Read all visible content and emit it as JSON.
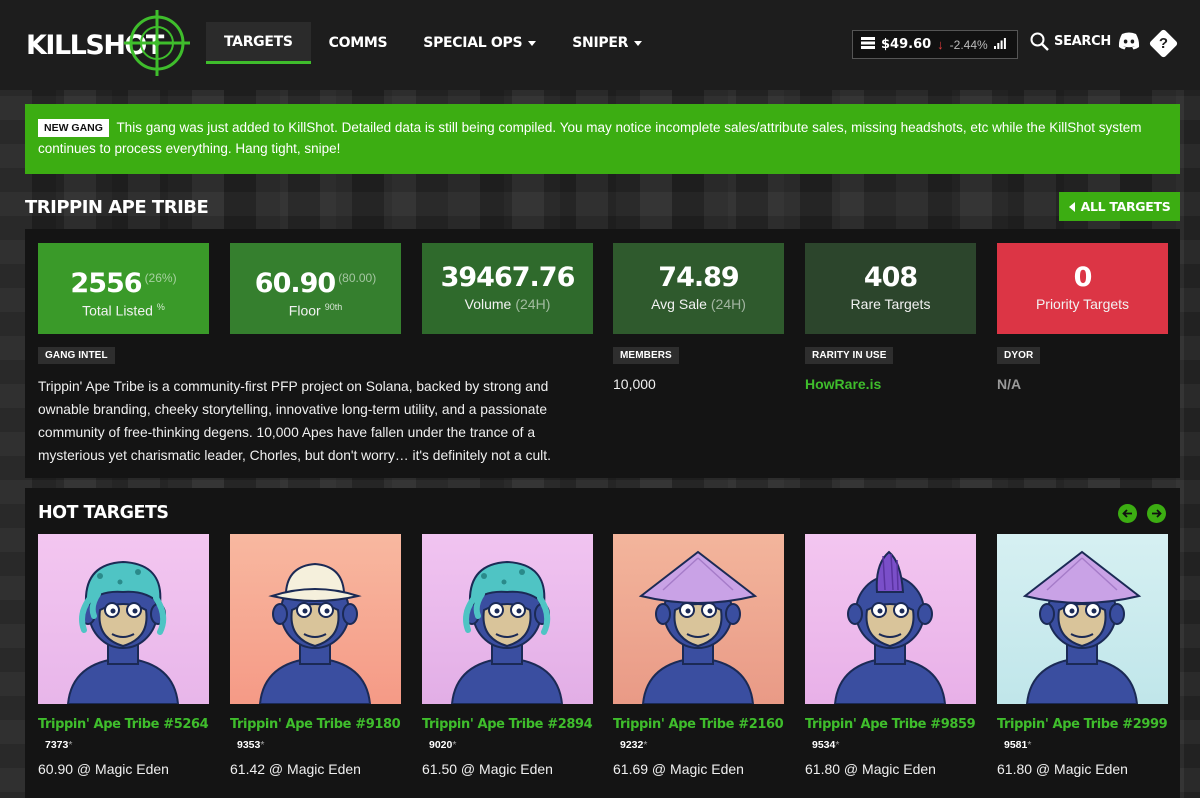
{
  "header": {
    "logo_text": "KILLSHOT",
    "nav": [
      {
        "label": "TARGETS",
        "active": true,
        "dropdown": false
      },
      {
        "label": "COMMS",
        "active": false,
        "dropdown": false
      },
      {
        "label": "SPECIAL OPS",
        "active": false,
        "dropdown": true
      },
      {
        "label": "SNIPER",
        "active": false,
        "dropdown": true
      }
    ],
    "price": "$49.60",
    "price_change": "-2.44%",
    "search_label": "SEARCH",
    "help_label": "?"
  },
  "alert": {
    "badge": "NEW GANG",
    "text": "This gang was just added to KillShot. Detailed data is still being compiled. You may notice incomplete sales/attribute sales, missing headshots, etc while the KillShot system continues to process everything. Hang tight, snipe!"
  },
  "page_title": "TRIPPIN APE TRIBE",
  "all_targets_label": "ALL TARGETS",
  "stats": [
    {
      "value": "2556",
      "sub": "(26%)",
      "label": "Total Listed",
      "label_sup": "%",
      "label_muted": "",
      "color": "#3a9a29"
    },
    {
      "value": "60.90",
      "sub": "(80.00)",
      "label": "Floor",
      "label_sup": "90th",
      "label_muted": "",
      "color": "#357f2e"
    },
    {
      "value": "39467.76",
      "sub": "",
      "label": "Volume",
      "label_sup": "",
      "label_muted": "(24H)",
      "color": "#2f6a2c"
    },
    {
      "value": "74.89",
      "sub": "",
      "label": "Avg Sale",
      "label_sup": "",
      "label_muted": "(24H)",
      "color": "#2f5a2d"
    },
    {
      "value": "408",
      "sub": "",
      "label": "Rare Targets",
      "label_sup": "",
      "label_muted": "",
      "color": "#2c452c"
    },
    {
      "value": "0",
      "sub": "",
      "label": "Priority Targets",
      "label_sup": "",
      "label_muted": "",
      "color": "#dc3545"
    }
  ],
  "info": {
    "gang_intel_tag": "GANG INTEL",
    "gang_intel_text": "Trippin' Ape Tribe is a community-first PFP project on Solana, backed by strong and ownable branding, cheeky storytelling, innovative long-term utility, and a passionate community of free-thinking degens. 10,000 Apes have fallen under the trance of a mysterious yet charismatic leader, Chorles, but don't worry… it's definitely not a cult.",
    "members_tag": "MEMBERS",
    "members_value": "10,000",
    "rarity_tag": "RARITY IN USE",
    "rarity_value": "HowRare.is",
    "dyor_tag": "DYOR",
    "dyor_value": "N/A"
  },
  "hot_targets": {
    "title": "HOT TARGETS",
    "items": [
      {
        "name": "Trippin' Ape Tribe #5264",
        "rank": "7373",
        "price": "60.90 @ Magic Eden",
        "bg": "#f3c6f0",
        "bg2": "#e8b6ea",
        "hat": "octopus"
      },
      {
        "name": "Trippin' Ape Tribe #9180",
        "rank": "9353",
        "price": "61.42 @ Magic Eden",
        "bg": "#f8b8a0",
        "bg2": "#f59a86",
        "hat": "bucket"
      },
      {
        "name": "Trippin' Ape Tribe #2894",
        "rank": "9020",
        "price": "61.50 @ Magic Eden",
        "bg": "#f1c4f1",
        "bg2": "#e2aee6",
        "hat": "octopus"
      },
      {
        "name": "Trippin' Ape Tribe #2160",
        "rank": "9232",
        "price": "61.69 @ Magic Eden",
        "bg": "#f3b59c",
        "bg2": "#e99a86",
        "hat": "conical"
      },
      {
        "name": "Trippin' Ape Tribe #9859",
        "rank": "9534",
        "price": "61.80 @ Magic Eden",
        "bg": "#f3c6f0",
        "bg2": "#e8b0e8",
        "hat": "mohawk"
      },
      {
        "name": "Trippin' Ape Tribe #2999",
        "rank": "9581",
        "price": "61.80 @ Magic Eden",
        "bg": "#d6f0f2",
        "bg2": "#c0e6ea",
        "hat": "conical"
      }
    ]
  }
}
